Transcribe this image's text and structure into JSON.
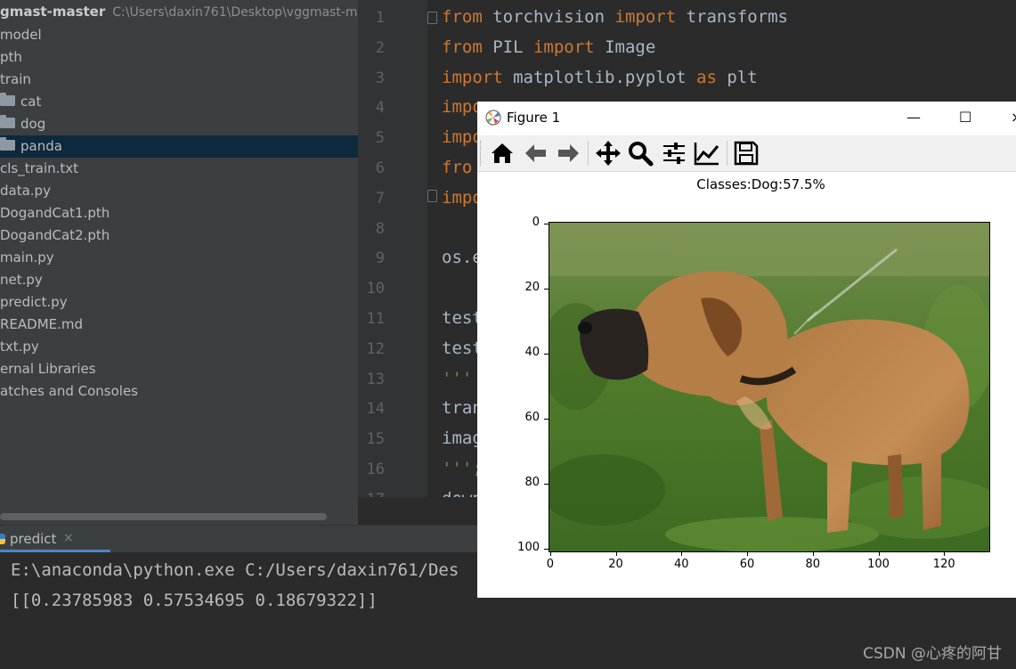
{
  "project": {
    "root_name": "gmast-master",
    "root_path": "C:\\Users\\daxin761\\Desktop\\vggmast-ma",
    "items": [
      {
        "label": "model",
        "folder": false
      },
      {
        "label": "pth",
        "folder": false
      },
      {
        "label": "train",
        "folder": false
      },
      {
        "label": "cat",
        "folder": true
      },
      {
        "label": "dog",
        "folder": true
      },
      {
        "label": "panda",
        "folder": true,
        "selected": true
      },
      {
        "label": "cls_train.txt",
        "folder": false
      },
      {
        "label": "data.py",
        "folder": false
      },
      {
        "label": "DogandCat1.pth",
        "folder": false
      },
      {
        "label": "DogandCat2.pth",
        "folder": false
      },
      {
        "label": "main.py",
        "folder": false
      },
      {
        "label": "net.py",
        "folder": false
      },
      {
        "label": "predict.py",
        "folder": false
      },
      {
        "label": "README.md",
        "folder": false
      },
      {
        "label": "txt.py",
        "folder": false
      },
      {
        "label": "ernal Libraries",
        "folder": false
      },
      {
        "label": "atches and Consoles",
        "folder": false
      }
    ]
  },
  "editor": {
    "line_numbers": [
      "1",
      "2",
      "3",
      "4",
      "5",
      "6",
      "7",
      "8",
      "9",
      "10",
      "11",
      "12",
      "13",
      "14",
      "15",
      "16",
      "17"
    ],
    "lines": [
      [
        [
          "kw",
          "from"
        ],
        [
          "",
          "torchvision "
        ],
        [
          "kw",
          "import"
        ],
        [
          "",
          "transforms"
        ]
      ],
      [
        [
          "kw",
          "from"
        ],
        [
          "",
          "PIL "
        ],
        [
          "kw",
          "import"
        ],
        [
          "",
          "Image"
        ]
      ],
      [
        [
          "kw",
          "import"
        ],
        [
          "",
          "matplotlib.pyplot "
        ],
        [
          "kw",
          "as"
        ],
        [
          "",
          "plt"
        ]
      ],
      [
        [
          "kw",
          "impo"
        ]
      ],
      [
        [
          "kw",
          "impo"
        ]
      ],
      [
        [
          "kw",
          "fro"
        ]
      ],
      [
        [
          "kw",
          "impo"
        ]
      ],
      [],
      [
        [
          "",
          "os.e"
        ]
      ],
      [],
      [
        [
          "",
          "test"
        ]
      ],
      [
        [
          "",
          "test"
        ]
      ],
      [
        [
          "str",
          "'''"
        ]
      ],
      [
        [
          "",
          "tran"
        ]
      ],
      [
        [
          "",
          "imag"
        ]
      ],
      [
        [
          "str",
          "''';"
        ]
      ],
      [
        [
          "",
          "down"
        ]
      ]
    ]
  },
  "run": {
    "tab_label": "predict",
    "tab_close": "×",
    "console_lines": [
      "E:\\anaconda\\python.exe C:/Users/daxin761/Des",
      "[[0.23785983 0.57534695 0.18679322]]"
    ]
  },
  "figure": {
    "window_title": "Figure 1",
    "minimize": "—",
    "maximize": "☐",
    "close": "×",
    "plot_title": "Classes:Dog:57.5%",
    "yticks": [
      "0",
      "20",
      "40",
      "60",
      "80",
      "100"
    ],
    "xticks": [
      "0",
      "20",
      "40",
      "60",
      "80",
      "100",
      "120"
    ],
    "toolbar_icons": [
      "home-icon",
      "back-arrow-icon",
      "forward-arrow-icon",
      "pan-icon",
      "zoom-icon",
      "subplots-icon",
      "edit-curve-icon",
      "save-icon"
    ]
  },
  "watermark": "CSDN @心疼的阿甘",
  "colors": {
    "keyword": "#cc7832",
    "selection": "#0d293e",
    "editor_bg": "#2b2b2b",
    "panel_bg": "#3c3f41"
  }
}
